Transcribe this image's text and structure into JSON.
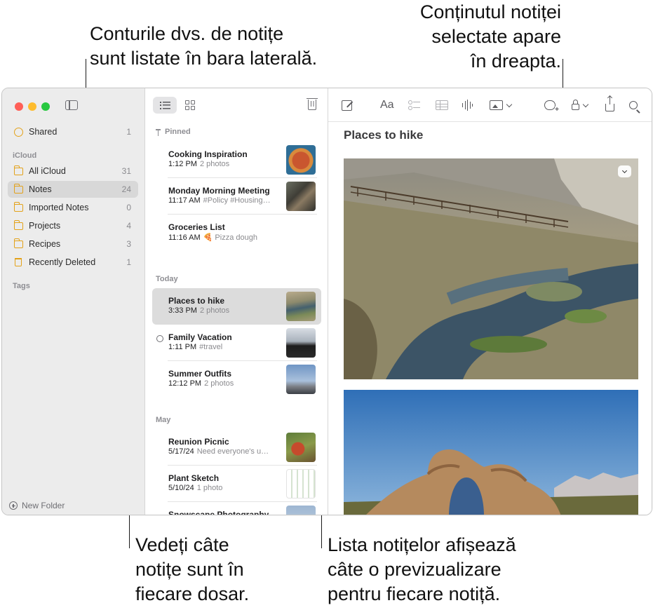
{
  "callouts": {
    "top_left": "Conturile dvs. de notițe\nsunt listate în bara laterală.",
    "top_right": "Conținutul notiței\nselectate apare\nîn dreapta.",
    "bottom_left": "Vedeți câte\nnotițe sunt în\nfiecare dosar.",
    "bottom_right": "Lista notițelor afișează\ncâte o previzualizare\npentru fiecare notiță."
  },
  "colors": {
    "traffic_red": "#ff5f57",
    "traffic_yellow": "#febc2e",
    "traffic_green": "#28c840",
    "folder_accent": "#e3a21a"
  },
  "sidebar": {
    "shared": {
      "label": "Shared",
      "count": "1",
      "icon": "person-circle-icon"
    },
    "icloud_header": "iCloud",
    "folders": [
      {
        "label": "All iCloud",
        "count": "31",
        "icon": "folder-icon"
      },
      {
        "label": "Notes",
        "count": "24",
        "icon": "folder-icon",
        "selected": true
      },
      {
        "label": "Imported Notes",
        "count": "0",
        "icon": "folder-icon"
      },
      {
        "label": "Projects",
        "count": "4",
        "icon": "folder-icon"
      },
      {
        "label": "Recipes",
        "count": "3",
        "icon": "folder-icon"
      },
      {
        "label": "Recently Deleted",
        "count": "1",
        "icon": "trash-icon"
      }
    ],
    "tags_header": "Tags",
    "new_folder": "New Folder"
  },
  "notelist": {
    "sections": {
      "pinned": "Pinned",
      "today": "Today",
      "may": "May"
    },
    "notes": [
      {
        "title": "Cooking Inspiration",
        "time": "1:12 PM",
        "preview": "2 photos",
        "thumb": "pizza"
      },
      {
        "title": "Monday Morning Meeting",
        "time": "11:17 AM",
        "preview": "#Policy #Housing…",
        "thumb": "meeting"
      },
      {
        "title": "Groceries List",
        "time": "11:16 AM",
        "preview": "🍕 Pizza dough",
        "thumb": ""
      },
      {
        "title": "Places to hike",
        "time": "3:33 PM",
        "preview": "2 photos",
        "thumb": "river",
        "selected": true
      },
      {
        "title": "Family Vacation",
        "time": "1:11 PM",
        "preview": "#travel",
        "thumb": "bike",
        "shared": true
      },
      {
        "title": "Summer Outfits",
        "time": "12:12 PM",
        "preview": "2 photos",
        "thumb": "outfit"
      },
      {
        "title": "Reunion Picnic",
        "time": "5/17/24",
        "preview": "Need everyone's u…",
        "thumb": "picnic"
      },
      {
        "title": "Plant Sketch",
        "time": "5/10/24",
        "preview": "1 photo",
        "thumb": "sketch"
      },
      {
        "title": "Snowscape Photography",
        "time": "",
        "preview": "",
        "thumb": "snow"
      }
    ]
  },
  "editor": {
    "title": "Places to hike",
    "font_button": "Aa",
    "images": [
      "hot-springs-creek",
      "rock-arch-sierra"
    ]
  }
}
